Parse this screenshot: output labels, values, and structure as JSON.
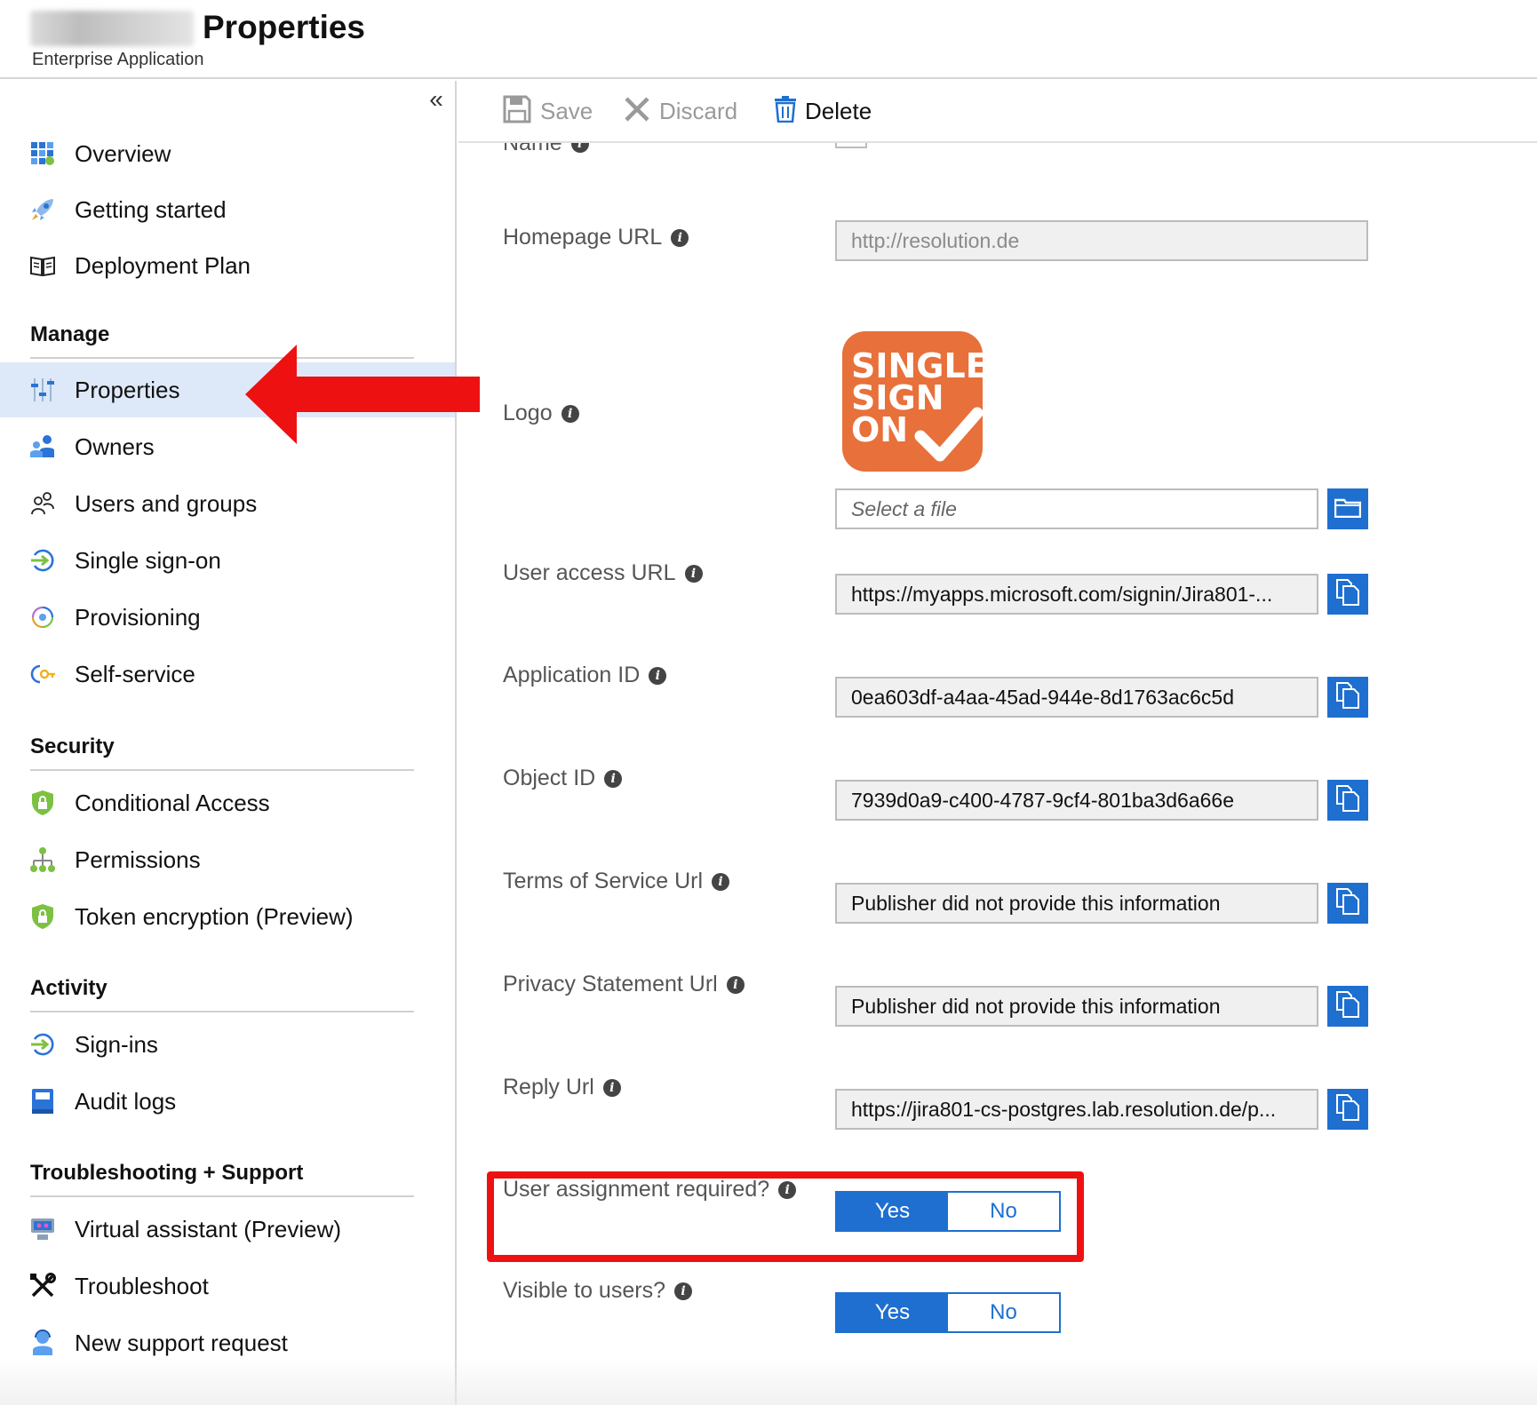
{
  "header": {
    "title": "Properties",
    "subtitle": "Enterprise Application"
  },
  "sidebar": {
    "collapse_glyph": "«",
    "top_items": [
      {
        "label": "Overview",
        "icon": "grid-icon"
      },
      {
        "label": "Getting started",
        "icon": "rocket-icon"
      },
      {
        "label": "Deployment Plan",
        "icon": "book-icon"
      }
    ],
    "sections": [
      {
        "heading": "Manage",
        "items": [
          {
            "label": "Properties",
            "icon": "sliders-icon",
            "active": true
          },
          {
            "label": "Owners",
            "icon": "people-icon"
          },
          {
            "label": "Users and groups",
            "icon": "user-group-icon"
          },
          {
            "label": "Single sign-on",
            "icon": "sign-in-arrow-icon"
          },
          {
            "label": "Provisioning",
            "icon": "provisioning-cycle-icon"
          },
          {
            "label": "Self-service",
            "icon": "key-icon"
          }
        ]
      },
      {
        "heading": "Security",
        "items": [
          {
            "label": "Conditional Access",
            "icon": "shield-lock-icon"
          },
          {
            "label": "Permissions",
            "icon": "hierarchy-icon"
          },
          {
            "label": "Token encryption (Preview)",
            "icon": "shield-lock-icon"
          }
        ]
      },
      {
        "heading": "Activity",
        "items": [
          {
            "label": "Sign-ins",
            "icon": "sign-in-arrow-icon"
          },
          {
            "label": "Audit logs",
            "icon": "log-book-icon"
          }
        ]
      },
      {
        "heading": "Troubleshooting + Support",
        "items": [
          {
            "label": "Virtual assistant (Preview)",
            "icon": "assistant-icon"
          },
          {
            "label": "Troubleshoot",
            "icon": "tools-icon"
          },
          {
            "label": "New support request",
            "icon": "support-person-icon"
          }
        ]
      }
    ]
  },
  "toolbar": {
    "save_label": "Save",
    "discard_label": "Discard",
    "delete_label": "Delete"
  },
  "form": {
    "name": {
      "label": "Name"
    },
    "homepage": {
      "label": "Homepage URL",
      "value": "http://resolution.de"
    },
    "logo": {
      "label": "Logo",
      "image_text": [
        "SINGLE",
        "SIGN",
        "ON"
      ],
      "file_placeholder": "Select a file"
    },
    "user_access_url": {
      "label": "User access URL",
      "value": "https://myapps.microsoft.com/signin/Jira801-..."
    },
    "application_id": {
      "label": "Application ID",
      "value": "0ea603df-a4aa-45ad-944e-8d1763ac6c5d"
    },
    "object_id": {
      "label": "Object ID",
      "value": "7939d0a9-c400-4787-9cf4-801ba3d6a66e"
    },
    "terms_url": {
      "label": "Terms of Service Url",
      "value": "Publisher did not provide this information"
    },
    "privacy_url": {
      "label": "Privacy Statement Url",
      "value": "Publisher did not provide this information"
    },
    "reply_url": {
      "label": "Reply Url",
      "value": "https://jira801-cs-postgres.lab.resolution.de/p..."
    },
    "user_assignment": {
      "label": "User assignment required?",
      "yes": "Yes",
      "no": "No",
      "selected": "Yes"
    },
    "visible_to_users": {
      "label": "Visible to users?",
      "yes": "Yes",
      "no": "No",
      "selected": "Yes"
    }
  },
  "colors": {
    "accent": "#1e6fd0",
    "active_nav": "#dde9f8",
    "annotation_red": "#ee1111",
    "logo_orange": "#e8703a"
  }
}
